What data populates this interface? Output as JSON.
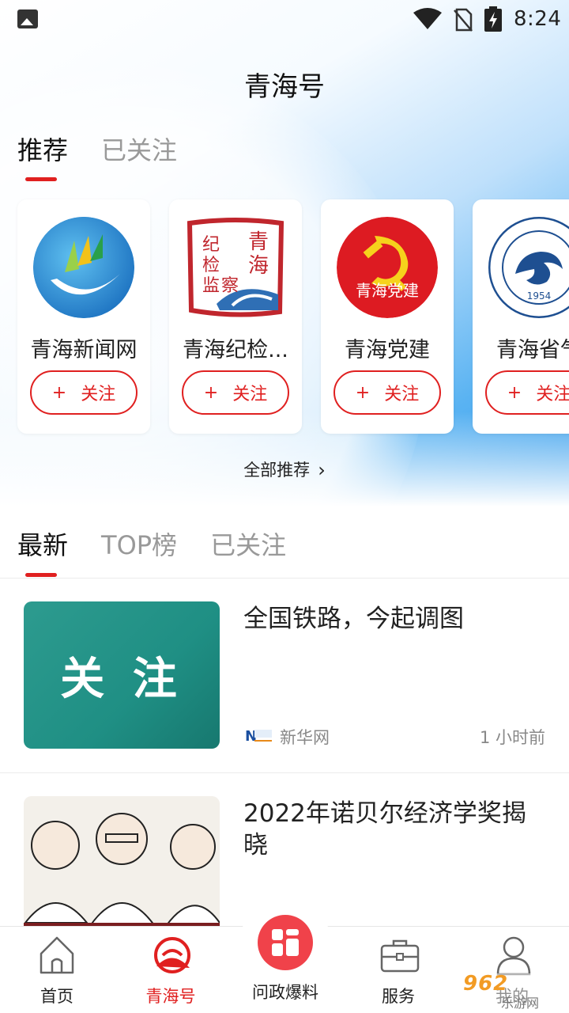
{
  "status_bar": {
    "time": "8:24",
    "icons": [
      "image-icon",
      "wifi-icon",
      "no-sim-icon",
      "battery-charging-icon"
    ]
  },
  "header": {
    "title": "青海号"
  },
  "top_tabs": [
    {
      "label": "推荐",
      "active": true
    },
    {
      "label": "已关注",
      "active": false
    }
  ],
  "accounts": [
    {
      "name": "青海新闻网",
      "follow_plus": "+",
      "follow_label": "关注",
      "logo": "qhnews-logo"
    },
    {
      "name": "青海纪检...",
      "follow_plus": "+",
      "follow_label": "关注",
      "logo": "qh-jijian-logo",
      "logo_text": [
        "纪",
        "检",
        "监",
        "察",
        "青",
        "海"
      ]
    },
    {
      "name": "青海党建",
      "follow_plus": "+",
      "follow_label": "关注",
      "logo": "party-building-logo",
      "logo_text": "青海党建"
    },
    {
      "name": "青海省气",
      "follow_plus": "+",
      "follow_label": "关注",
      "logo": "qh-meteorological-logo",
      "logo_text": "1954"
    }
  ],
  "all_recommend": {
    "label": "全部推荐"
  },
  "news_tabs": [
    {
      "label": "最新",
      "active": true
    },
    {
      "label": "TOP榜",
      "active": false
    },
    {
      "label": "已关注",
      "active": false
    }
  ],
  "news": [
    {
      "headline": "全国铁路，今起调图",
      "thumb_text": "关 注",
      "source": "新华网",
      "time": "1 小时前",
      "source_icon": "xinhua-net-icon"
    },
    {
      "headline": "2022年诺贝尔经济学奖揭晓",
      "thumb_text": "",
      "source": "",
      "time": "",
      "source_icon": ""
    }
  ],
  "bottom_nav": [
    {
      "label": "首页",
      "icon": "home-icon",
      "active": false
    },
    {
      "label": "青海号",
      "icon": "qinghai-hao-icon",
      "active": true
    },
    {
      "label": "问政爆料",
      "icon": "report-icon",
      "active": false
    },
    {
      "label": "服务",
      "icon": "briefcase-icon",
      "active": false
    },
    {
      "label": "我的",
      "icon": "user-icon",
      "active": false
    }
  ],
  "watermark": {
    "big": "962",
    "sub": "乐游网"
  },
  "colors": {
    "accent": "#e02020",
    "tab_inactive": "#999999",
    "text": "#222222"
  }
}
